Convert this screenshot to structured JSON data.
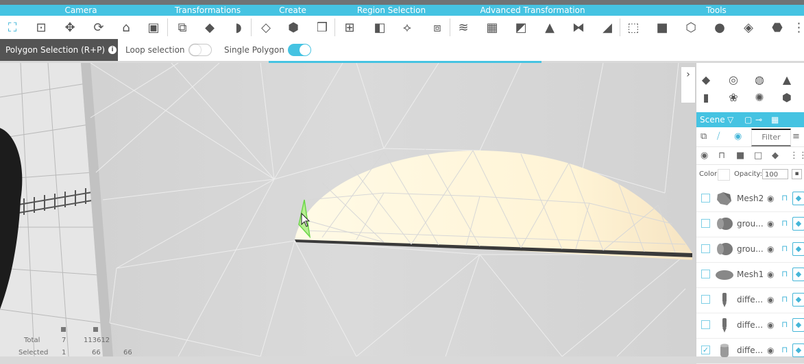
{
  "categories": [
    "Camera",
    "Transformations",
    "Create",
    "Region Selection",
    "Advanced Transformation",
    "Tools"
  ],
  "mode": {
    "title": "Polygon Selection (R+P)",
    "loop_label": "Loop selection",
    "loop_on": false,
    "single_label": "Single Polygon",
    "single_on": true
  },
  "scene": {
    "title": "Scene",
    "filter_placeholder": "Filter",
    "color_label": "Color:",
    "opacity_label": "Opacity:",
    "opacity_value": "100",
    "rows": [
      {
        "name": "Mesh2",
        "checked": false
      },
      {
        "name": "grou...",
        "checked": false
      },
      {
        "name": "grou...",
        "checked": false
      },
      {
        "name": "Mesh1",
        "checked": false
      },
      {
        "name": "diffe...",
        "checked": false
      },
      {
        "name": "diffe...",
        "checked": false
      },
      {
        "name": "diffe...",
        "checked": true
      }
    ]
  },
  "stats": {
    "total_label": "Total",
    "total_a": "7",
    "total_b": "113612",
    "selected_label": "Selected",
    "selected_a": "1",
    "selected_b": "66",
    "selected_c": "66"
  },
  "colors": {
    "accent": "#45c3e2",
    "mode_bg": "#545454",
    "selection": "#7ee05a",
    "face_fill": "#fff6d9"
  }
}
